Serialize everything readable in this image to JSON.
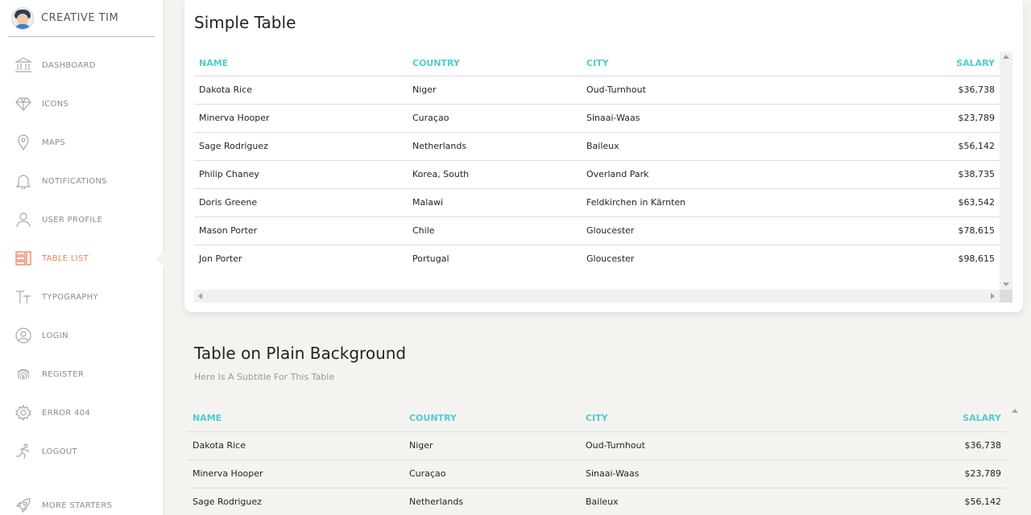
{
  "brand": {
    "name": "CREATIVE TIM"
  },
  "sidebar": {
    "items": [
      {
        "label": "DASHBOARD",
        "icon": "bank-icon"
      },
      {
        "label": "ICONS",
        "icon": "diamond-icon"
      },
      {
        "label": "MAPS",
        "icon": "pin-icon"
      },
      {
        "label": "NOTIFICATIONS",
        "icon": "bell-icon"
      },
      {
        "label": "USER PROFILE",
        "icon": "user-icon"
      },
      {
        "label": "TABLE LIST",
        "icon": "tile-icon",
        "active": true
      },
      {
        "label": "TYPOGRAPHY",
        "icon": "caps-icon"
      },
      {
        "label": "LOGIN",
        "icon": "user-circle-icon"
      },
      {
        "label": "REGISTER",
        "icon": "fingerprint-icon"
      },
      {
        "label": "ERROR 404",
        "icon": "settings-icon"
      },
      {
        "label": "LOGOUT",
        "icon": "runner-icon"
      },
      {
        "label": "MORE STARTERS",
        "icon": "spaceship-icon"
      }
    ]
  },
  "colors": {
    "accent": "#51cbce",
    "active": "#ef8157",
    "sidebar_text": "#8f8c88",
    "background": "#f4f3ef"
  },
  "simple_table": {
    "title": "Simple Table",
    "headers": [
      "NAME",
      "COUNTRY",
      "CITY",
      "SALARY"
    ],
    "rows": [
      [
        "Dakota Rice",
        "Niger",
        "Oud-Turnhout",
        "$36,738"
      ],
      [
        "Minerva Hooper",
        "Curaçao",
        "Sinaai-Waas",
        "$23,789"
      ],
      [
        "Sage Rodriguez",
        "Netherlands",
        "Baileux",
        "$56,142"
      ],
      [
        "Philip Chaney",
        "Korea, South",
        "Overland Park",
        "$38,735"
      ],
      [
        "Doris Greene",
        "Malawi",
        "Feldkirchen in Kärnten",
        "$63,542"
      ],
      [
        "Mason Porter",
        "Chile",
        "Gloucester",
        "$78,615"
      ],
      [
        "Jon Porter",
        "Portugal",
        "Gloucester",
        "$98,615"
      ]
    ]
  },
  "plain_table": {
    "title": "Table on Plain Background",
    "subtitle": "Here Is A Subtitle For This Table",
    "headers": [
      "NAME",
      "COUNTRY",
      "CITY",
      "SALARY"
    ],
    "rows": [
      [
        "Dakota Rice",
        "Niger",
        "Oud-Turnhout",
        "$36,738"
      ],
      [
        "Minerva Hooper",
        "Curaçao",
        "Sinaai-Waas",
        "$23,789"
      ],
      [
        "Sage Rodriguez",
        "Netherlands",
        "Baileux",
        "$56,142"
      ]
    ]
  }
}
